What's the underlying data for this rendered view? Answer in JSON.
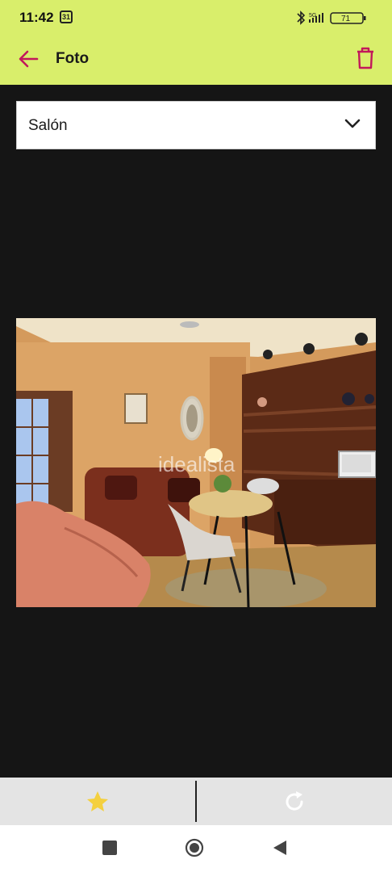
{
  "status_bar": {
    "time": "11:42",
    "calendar_day": "31",
    "network": "5G",
    "battery": "71"
  },
  "app_bar": {
    "title": "Foto",
    "back_icon": "arrow-left-icon",
    "delete_icon": "trash-icon"
  },
  "room_select": {
    "selected": "Salón",
    "icon": "chevron-down-icon"
  },
  "photo": {
    "watermark": "idealista"
  },
  "action_bar": {
    "star_icon": "star-icon",
    "refresh_icon": "refresh-icon"
  },
  "colors": {
    "appbar_bg": "#d9ee6b",
    "accent": "#c2185b",
    "star": "#f4d03f",
    "background": "#151515"
  }
}
